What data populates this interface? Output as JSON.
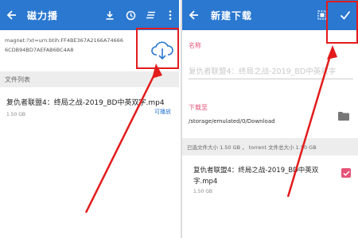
{
  "left": {
    "title": "磁力播",
    "toolbar_icons": [
      "download-icon",
      "history-icon",
      "sort-icon",
      "more-vert-icon"
    ],
    "magnet_text": "magnet:?xt=urn:btih:FF4BE367A2166A746666CDB94BD7AEFAB6BC4A8",
    "file_list_header": "文件列表",
    "file": {
      "name": "复仇者联盟4：终局之战-2019_BD中英双字.mp4",
      "size": "1.50 GB",
      "playable_label": "可播放"
    }
  },
  "right": {
    "title": "新建下载",
    "name_label": "名称",
    "name_value": "复仇者联盟4：终局之战-2019_BD中英双字",
    "download_to_label": "下载至",
    "download_path": "/storage/emulated/0/Download",
    "summary": "已选文件大小 1.50 GB ， torrent 文件总大小 1.50 GB",
    "file": {
      "name": "复仇者联盟4：终局之战-2019_BD中英双字.mp4",
      "size": "1.50 GB",
      "checked": true
    }
  },
  "colors": {
    "appbar": "#2a78d0",
    "accent_pink": "#e45477",
    "annotation_red": "#e31b1b"
  }
}
